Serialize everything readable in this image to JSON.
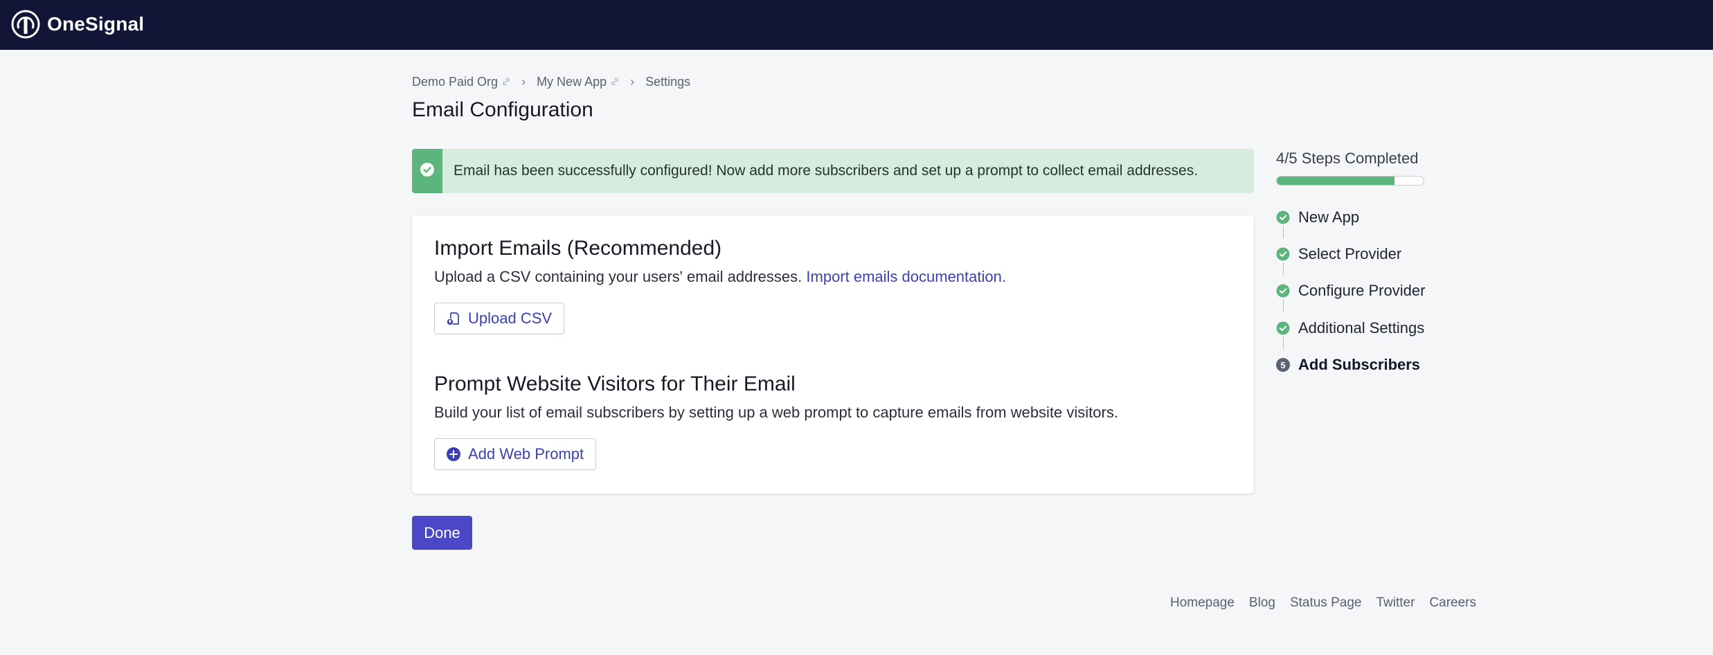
{
  "brand": {
    "name": "OneSignal"
  },
  "breadcrumb": {
    "items": [
      {
        "label": "Demo Paid Org"
      },
      {
        "label": "My New App"
      },
      {
        "label": "Settings"
      }
    ],
    "separator": "›"
  },
  "page": {
    "title": "Email Configuration"
  },
  "alert": {
    "text": "Email has been successfully configured! Now add more subscribers and set up a prompt to collect email addresses."
  },
  "import_section": {
    "title": "Import Emails (Recommended)",
    "description": "Upload a CSV containing your users' email addresses.",
    "link_text": "Import emails documentation.",
    "button_label": "Upload CSV"
  },
  "prompt_section": {
    "title": "Prompt Website Visitors for Their Email",
    "description": "Build your list of email subscribers by setting up a web prompt to capture emails from website visitors.",
    "button_label": "Add Web Prompt"
  },
  "done_button": {
    "label": "Done"
  },
  "steps": {
    "heading": "4/5 Steps Completed",
    "progress_fraction": 0.8,
    "items": [
      {
        "label": "New App",
        "status": "complete"
      },
      {
        "label": "Select Provider",
        "status": "complete"
      },
      {
        "label": "Configure Provider",
        "status": "complete"
      },
      {
        "label": "Additional Settings",
        "status": "complete"
      },
      {
        "label": "Add Subscribers",
        "status": "current",
        "number": "5"
      }
    ]
  },
  "footer": {
    "links": [
      "Homepage",
      "Blog",
      "Status Page",
      "Twitter",
      "Careers"
    ]
  },
  "colors": {
    "topbar": "#131536",
    "accent": "#4a48c8",
    "link": "#3b3fb6",
    "success": "#5cb57c",
    "alert_bg": "#d6ecdf"
  },
  "icons": {
    "logo": "onesignal-logo-icon",
    "breadcrumb_link": "link-icon",
    "alert": "check-circle-icon",
    "upload": "file-upload-icon",
    "add": "plus-circle-icon",
    "step_complete": "check-circle-icon"
  }
}
